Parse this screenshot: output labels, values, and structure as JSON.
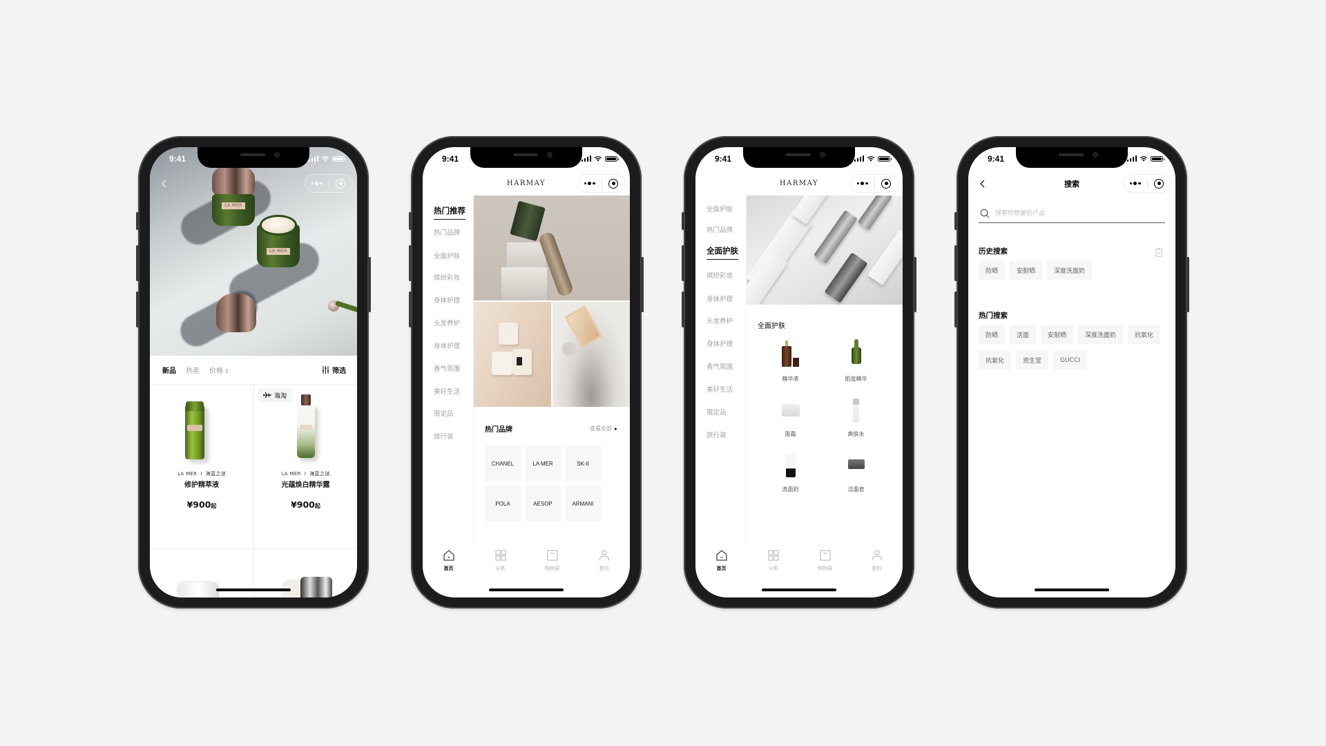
{
  "status_bar": {
    "time": "9:41"
  },
  "phones": {
    "product_list": {
      "filter_tabs": [
        {
          "label": "新品",
          "active": true
        },
        {
          "label": "热卖",
          "active": false
        },
        {
          "label": "价格",
          "active": false
        }
      ],
      "filter_button": "筛选",
      "products": [
        {
          "brand": "LA MER",
          "series": "海蓝之谜",
          "name": "修护精萃液",
          "price": "¥900",
          "price_suffix": "起",
          "badge": ""
        },
        {
          "brand": "LA MER",
          "series": "海蓝之谜",
          "name": "光蕴焕白精华露",
          "price": "¥900",
          "price_suffix": "起",
          "badge": "海淘"
        }
      ],
      "hero_label": "LA MER"
    },
    "home": {
      "logo": "HARMAY",
      "sidebar": [
        "热门推荐",
        "热门品牌",
        "全面护肤",
        "缤纷彩妆",
        "身体护理",
        "头发养护",
        "身体护理",
        "香气氛围",
        "美好生活",
        "限定品",
        "旅行装"
      ],
      "sidebar_active": "热门推荐",
      "brands_section": {
        "title": "热门品牌",
        "more": "查看全部",
        "brands": [
          "CHANEL",
          "LA MER",
          "SK-II",
          "POLA",
          "AESOP",
          "ARMANI"
        ]
      }
    },
    "category": {
      "logo": "HARMAY",
      "sidebar": [
        "全面护肤",
        "热门品牌",
        "全面护肤",
        "缤纷彩妆",
        "身体护理",
        "头发养护",
        "身体护理",
        "香气氛围",
        "美好生活",
        "限定品",
        "旅行装"
      ],
      "sidebar_active": "全面护肤",
      "section_title": "全面护肤",
      "items": [
        "精华液",
        "肌底精华",
        "面霜",
        "爽肤水",
        "洗面奶",
        "洁面皂"
      ]
    },
    "search": {
      "title": "搜索",
      "placeholder": "搜索你想要的产品",
      "history_title": "历史搜索",
      "history": [
        "防晒",
        "安耐晒",
        "深度洗面奶"
      ],
      "hot_title": "热门搜索",
      "hot": [
        "防晒",
        "洁面",
        "安耐晒",
        "深度洗面奶",
        "抗氧化",
        "抗氧化",
        "资生堂",
        "GUCCI"
      ]
    }
  },
  "tabbar": [
    {
      "label": "首页",
      "icon": "home-icon",
      "active": true
    },
    {
      "label": "分类",
      "icon": "grid-icon",
      "active": false
    },
    {
      "label": "购物袋",
      "icon": "bag-icon",
      "active": false
    },
    {
      "label": "我的",
      "icon": "user-icon",
      "active": false
    }
  ]
}
